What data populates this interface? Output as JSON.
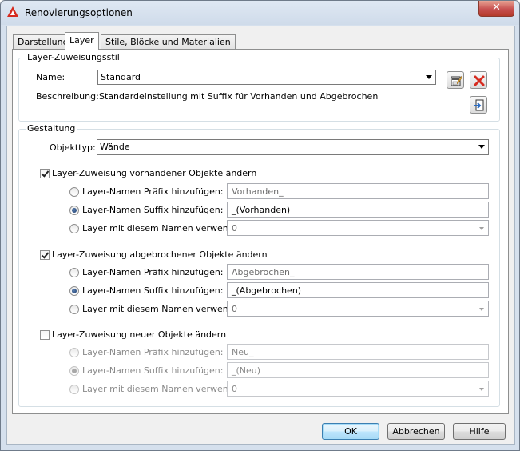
{
  "window": {
    "title": "Renovierungsoptionen",
    "close_label": "✕"
  },
  "tabs": [
    {
      "label": "Darstellung"
    },
    {
      "label": "Layer"
    },
    {
      "label": "Stile, Blöcke und Materialien"
    }
  ],
  "style_group": {
    "title": "Layer-Zuweisungsstil",
    "name_label": "Name:",
    "name_value": "Standard",
    "description_label": "Beschreibung:",
    "description_value": "Standardeinstellung mit Suffix für Vorhanden und Abgebrochen"
  },
  "design_group": {
    "title": "Gestaltung",
    "object_type_label": "Objekttyp:",
    "object_type_value": "Wände",
    "sections": [
      {
        "checkbox_label": "Layer-Zuweisung vorhandener Objekte ändern",
        "checked": true,
        "options": [
          {
            "label": "Layer-Namen Präfix hinzufügen:",
            "value": "Vorhanden_"
          },
          {
            "label": "Layer-Namen Suffix hinzufügen:",
            "value": "_(Vorhanden)"
          },
          {
            "label": "Layer mit diesem Namen verwenden:",
            "value": "0"
          }
        ],
        "selected_option": 1
      },
      {
        "checkbox_label": "Layer-Zuweisung abgebrochener Objekte ändern",
        "checked": true,
        "options": [
          {
            "label": "Layer-Namen Präfix hinzufügen:",
            "value": "Abgebrochen_"
          },
          {
            "label": "Layer-Namen Suffix hinzufügen:",
            "value": "_(Abgebrochen)"
          },
          {
            "label": "Layer mit diesem Namen verwenden:",
            "value": "0"
          }
        ],
        "selected_option": 1
      },
      {
        "checkbox_label": "Layer-Zuweisung neuer Objekte ändern",
        "checked": false,
        "options": [
          {
            "label": "Layer-Namen Präfix hinzufügen:",
            "value": "Neu_"
          },
          {
            "label": "Layer-Namen Suffix hinzufügen:",
            "value": "_(Neu)"
          },
          {
            "label": "Layer mit diesem Namen verwenden:",
            "value": "0"
          }
        ],
        "selected_option": 1
      }
    ]
  },
  "buttons": {
    "ok": "OK",
    "cancel": "Abbrechen",
    "help": "Hilfe"
  },
  "icons": {
    "app": "autocad-logo-icon",
    "edit_style": "edit-style-icon",
    "delete_style": "delete-icon",
    "import_style": "import-style-icon"
  },
  "colors": {
    "accent_red": "#d62a1e",
    "default_button_border": "#3c7fb1"
  }
}
